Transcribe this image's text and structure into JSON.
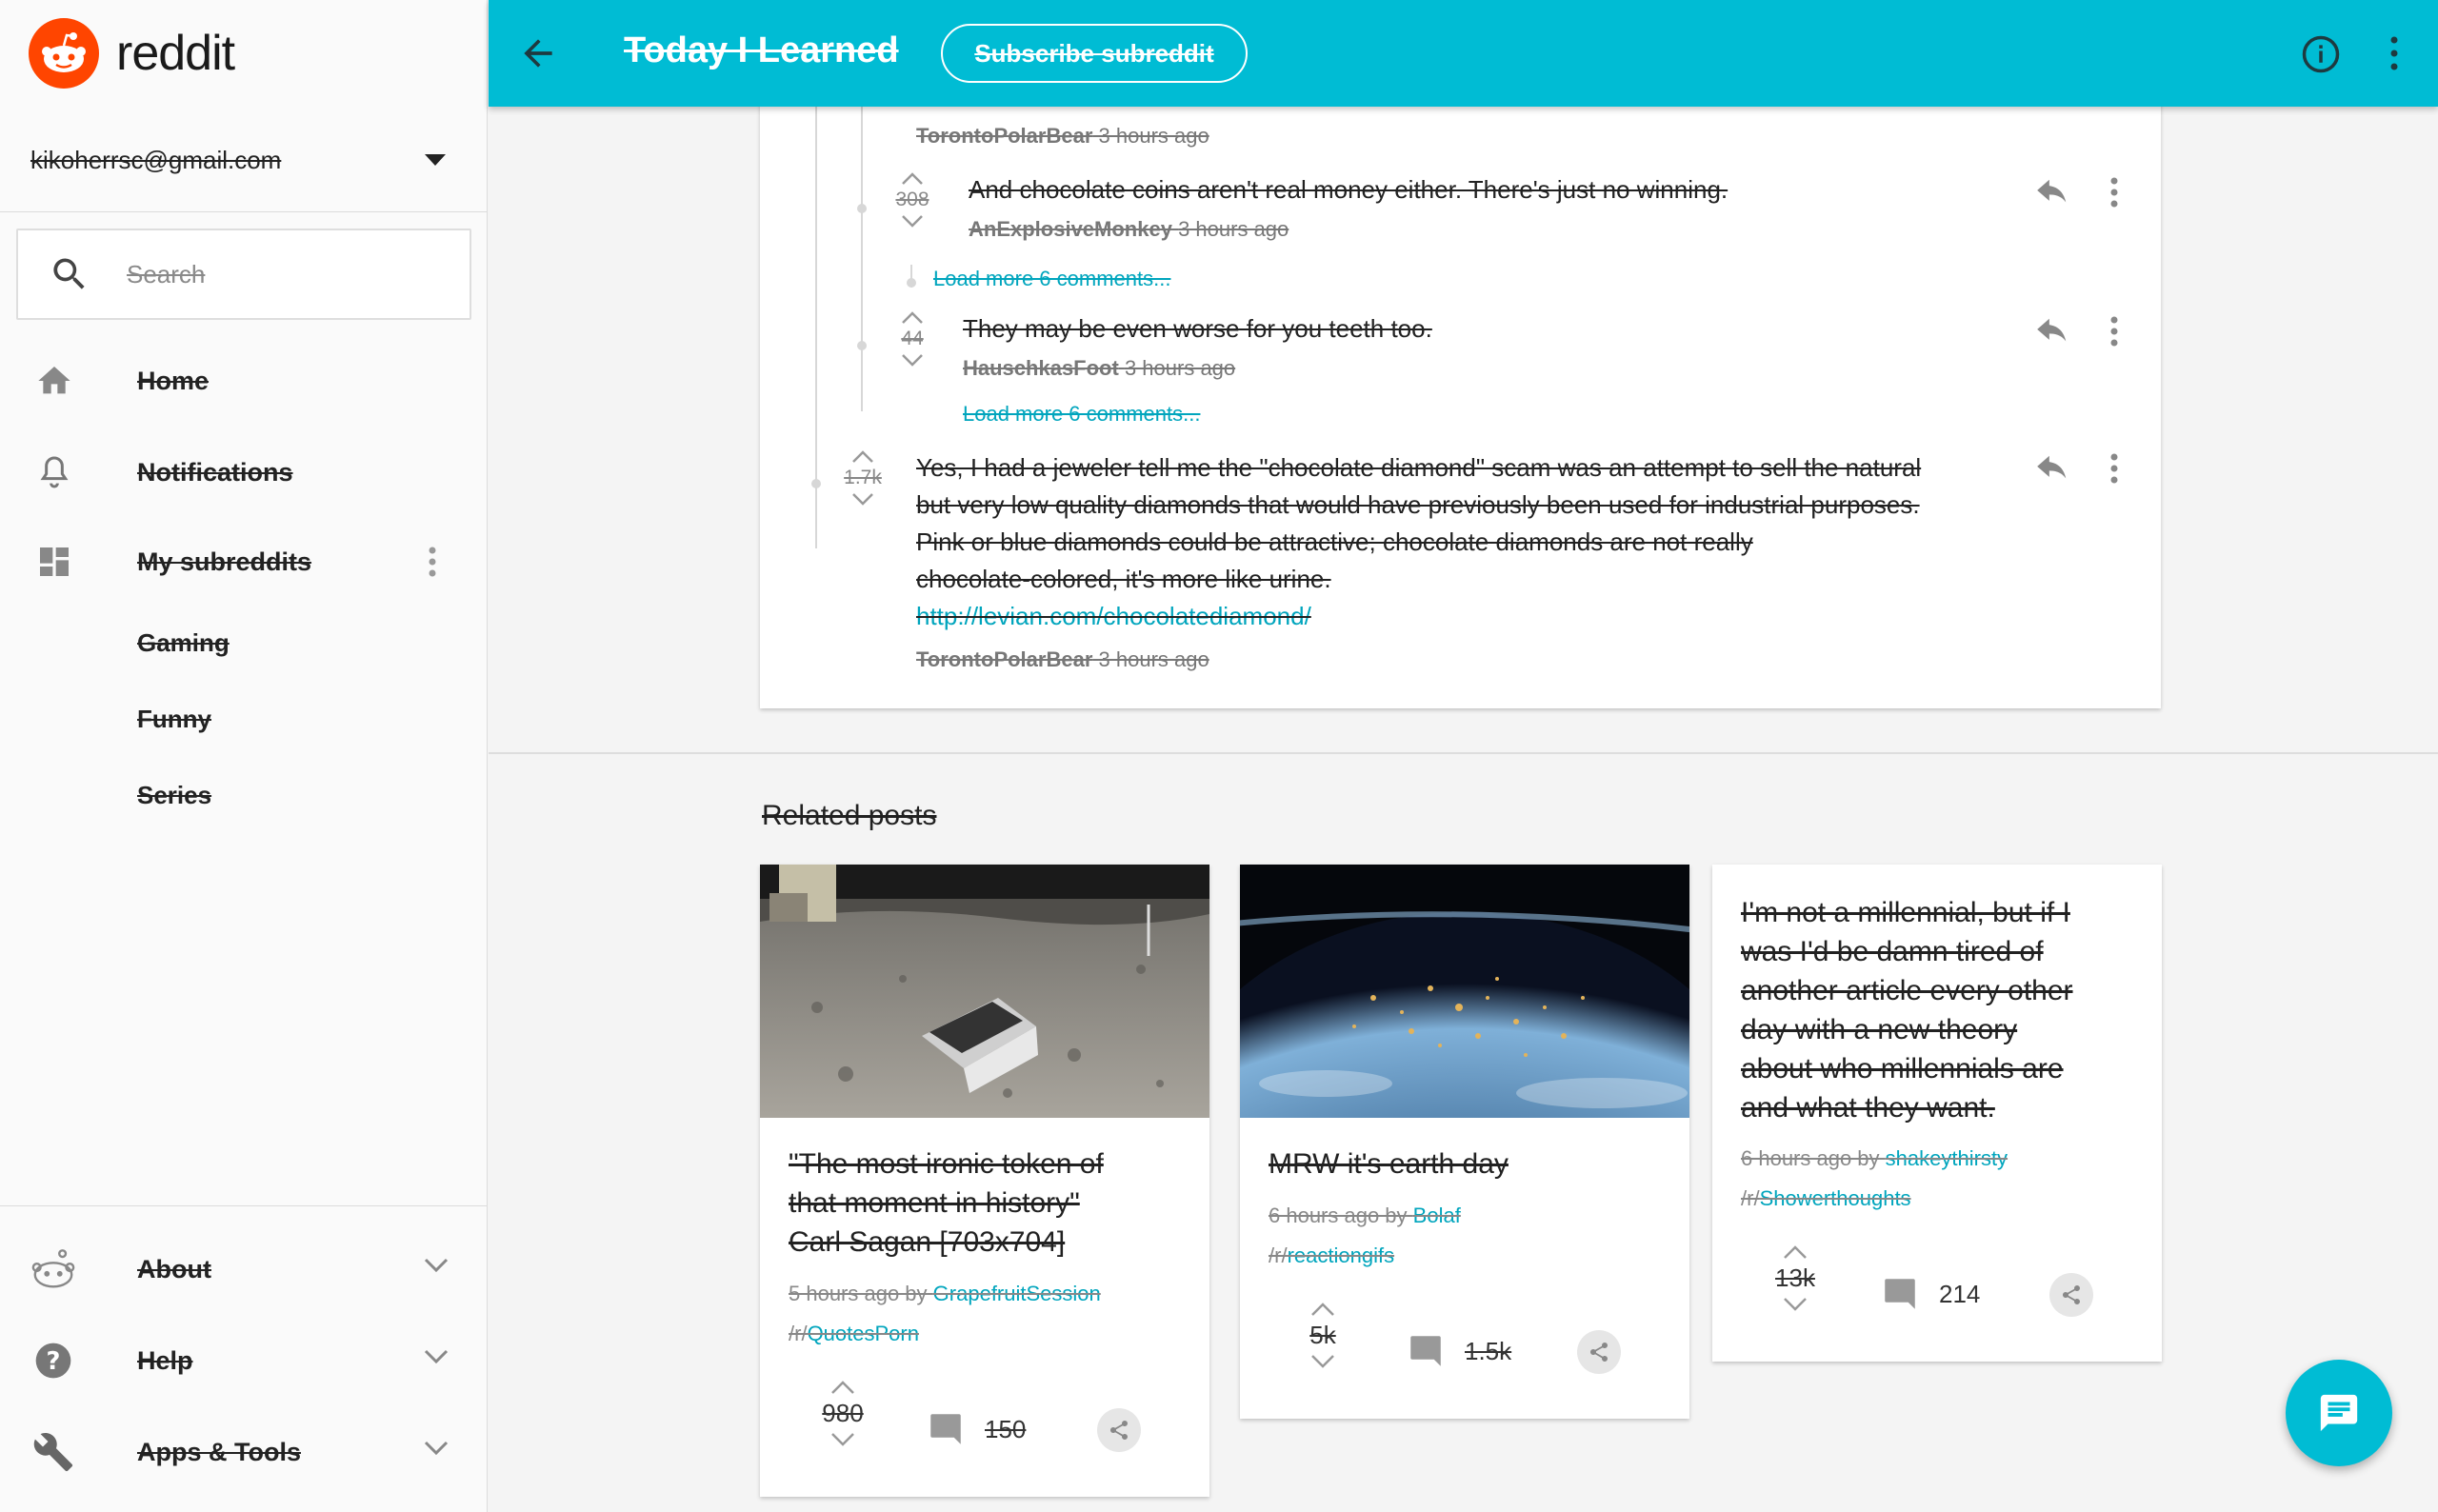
{
  "app": {
    "logo_text": "reddit"
  },
  "account": {
    "email": "kikoherrsc@gmail.com"
  },
  "search": {
    "placeholder": "Search"
  },
  "nav": {
    "home": "Home",
    "notifications": "Notifications",
    "my_subreddits": "My subreddits",
    "subreddits": [
      "Gaming",
      "Funny",
      "Series"
    ]
  },
  "footer_nav": {
    "about": "About",
    "help": "Help",
    "apps_tools": "Apps & Tools"
  },
  "topbar": {
    "title": "Today I Learned",
    "subscribe_label": "Subscribe subreddit",
    "bg_color": "#00bcd4"
  },
  "comments": {
    "top_meta": {
      "author": "TorontoPolarBear",
      "time": "3 hours ago"
    },
    "items": [
      {
        "score": "308",
        "text": "And chocolate coins aren't real money either. There's just no winning.",
        "author": "AnExplosiveMonkey",
        "time": "3 hours ago"
      },
      {
        "score": "44",
        "text": "They may be even worse for you teeth too.",
        "author": "HauschkasFoot",
        "time": "3 hours ago"
      },
      {
        "score": "1.7k",
        "text_lines": [
          "Yes, I had a jeweler tell me the \"chocolate diamond\" scam was an attempt to sell the natural",
          "but very low quality diamonds that would have previously been used for industrial purposes.",
          "Pink or blue diamonds could be attractive; chocolate diamonds are not really",
          "chocolate-colored, it's more like urine."
        ],
        "link": "http://levian.com/chocolatediamond/",
        "author": "TorontoPolarBear",
        "time": "3 hours ago"
      }
    ],
    "load_more_1": "Load more 6 comments...",
    "load_more_2": "Load more 6 comments..."
  },
  "related": {
    "heading": "Related posts",
    "posts": [
      {
        "title_lines": [
          "\"The most ironic token of",
          "that moment in history\"",
          "Carl Sagan [703x704]"
        ],
        "time": "5 hours ago by",
        "author": "GrapefruitSession",
        "sub_prefix": "/r/",
        "subreddit": "QuotesPorn",
        "score": "980",
        "comments": "150"
      },
      {
        "title_lines": [
          "MRW it's earth day"
        ],
        "time": "6 hours ago by",
        "author": "Bolaf",
        "sub_prefix": "/r/",
        "subreddit": "reactiongifs",
        "score": "5k",
        "comments": "1.5k"
      },
      {
        "title_lines": [
          "I'm not a millennial, but if I",
          "was I'd be damn tired of",
          "another article every other",
          "day with a new theory",
          "about who millennials are",
          "and what they want."
        ],
        "time": "6 hours ago by",
        "author": "shakeythirsty",
        "sub_prefix": "/r/",
        "subreddit": "Showerthoughts",
        "score": "13k",
        "comments": "214"
      }
    ]
  },
  "colors": {
    "accent": "#00bcd4",
    "link": "#00a5bd",
    "reddit_orange": "#ff4500"
  }
}
